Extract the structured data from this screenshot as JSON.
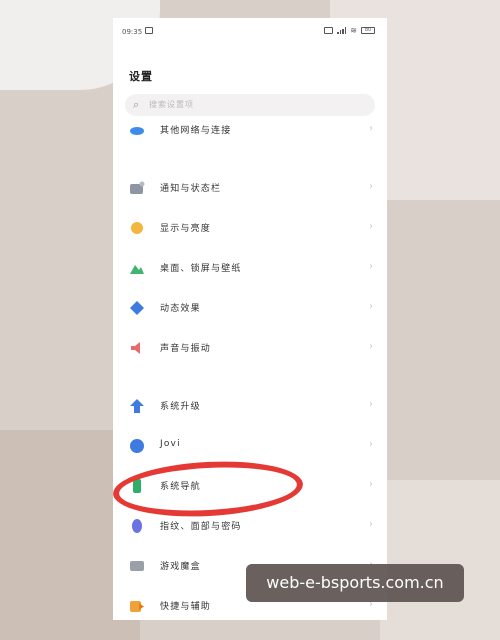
{
  "status_bar": {
    "time": "09:35",
    "battery": "80"
  },
  "header": {
    "title": "设置"
  },
  "search": {
    "placeholder": "搜索设置项"
  },
  "settings_items": [
    {
      "label": "其他网络与连接",
      "icon": "network-icon"
    },
    {
      "label": "通知与状态栏",
      "icon": "notification-icon"
    },
    {
      "label": "显示与亮度",
      "icon": "brightness-icon"
    },
    {
      "label": "桌面、锁屏与壁纸",
      "icon": "wallpaper-icon"
    },
    {
      "label": "动态效果",
      "icon": "animation-icon"
    },
    {
      "label": "声音与振动",
      "icon": "sound-icon"
    },
    {
      "label": "系统升级",
      "icon": "upgrade-icon"
    },
    {
      "label": "Jovi",
      "icon": "jovi-icon"
    },
    {
      "label": "系统导航",
      "icon": "navigation-icon"
    },
    {
      "label": "指纹、面部与密码",
      "icon": "fingerprint-icon"
    },
    {
      "label": "游戏魔盒",
      "icon": "game-box-icon"
    },
    {
      "label": "快捷与辅助",
      "icon": "shortcut-icon"
    }
  ],
  "watermark": {
    "text": "web-e-bsports.com.cn"
  },
  "colors": {
    "annotation": "#e53935",
    "accent": "#3d7be0"
  }
}
